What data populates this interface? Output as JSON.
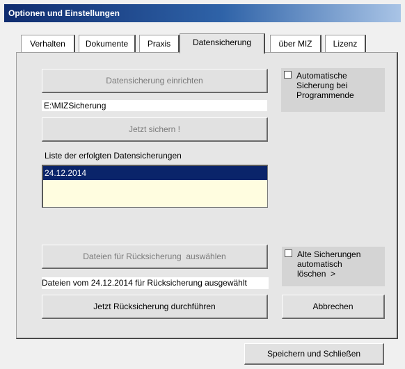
{
  "window": {
    "title": "Optionen und Einstellungen"
  },
  "tabs": [
    {
      "label": "Verhalten",
      "active": false
    },
    {
      "label": "Dokumente",
      "active": false
    },
    {
      "label": "Praxis",
      "active": false
    },
    {
      "label": "Datensicherung",
      "active": true
    },
    {
      "label": "über MIZ",
      "active": false
    },
    {
      "label": "Lizenz",
      "active": false
    }
  ],
  "backup": {
    "setup_button": "Datensicherung einrichten",
    "path_value": "E:\\MIZSicherung",
    "backup_now_button": "Jetzt sichern !",
    "list_label": "Liste der erfolgten Datensicherungen",
    "list_items": [
      "24.12.2014"
    ],
    "auto_backup_checkbox": {
      "label": "Automatische Sicherung bei Programmende",
      "line1": "Automatische",
      "line2": "Sicherung bei",
      "line3": "Programmende",
      "checked": false
    }
  },
  "restore": {
    "select_button": "Dateien für Rücksicherung  auswählen",
    "status_text": "Dateien vom 24.12.2014 für Rücksicherung ausgewählt",
    "perform_button": "Jetzt Rücksicherung durchführen",
    "cancel_button": "Abbrechen",
    "delete_old_checkbox": {
      "line1": "Alte Sicherungen",
      "line2": "automatisch",
      "line3": "löschen  >",
      "checked": false
    }
  },
  "footer": {
    "save_close_button": "Speichern und Schließen"
  }
}
